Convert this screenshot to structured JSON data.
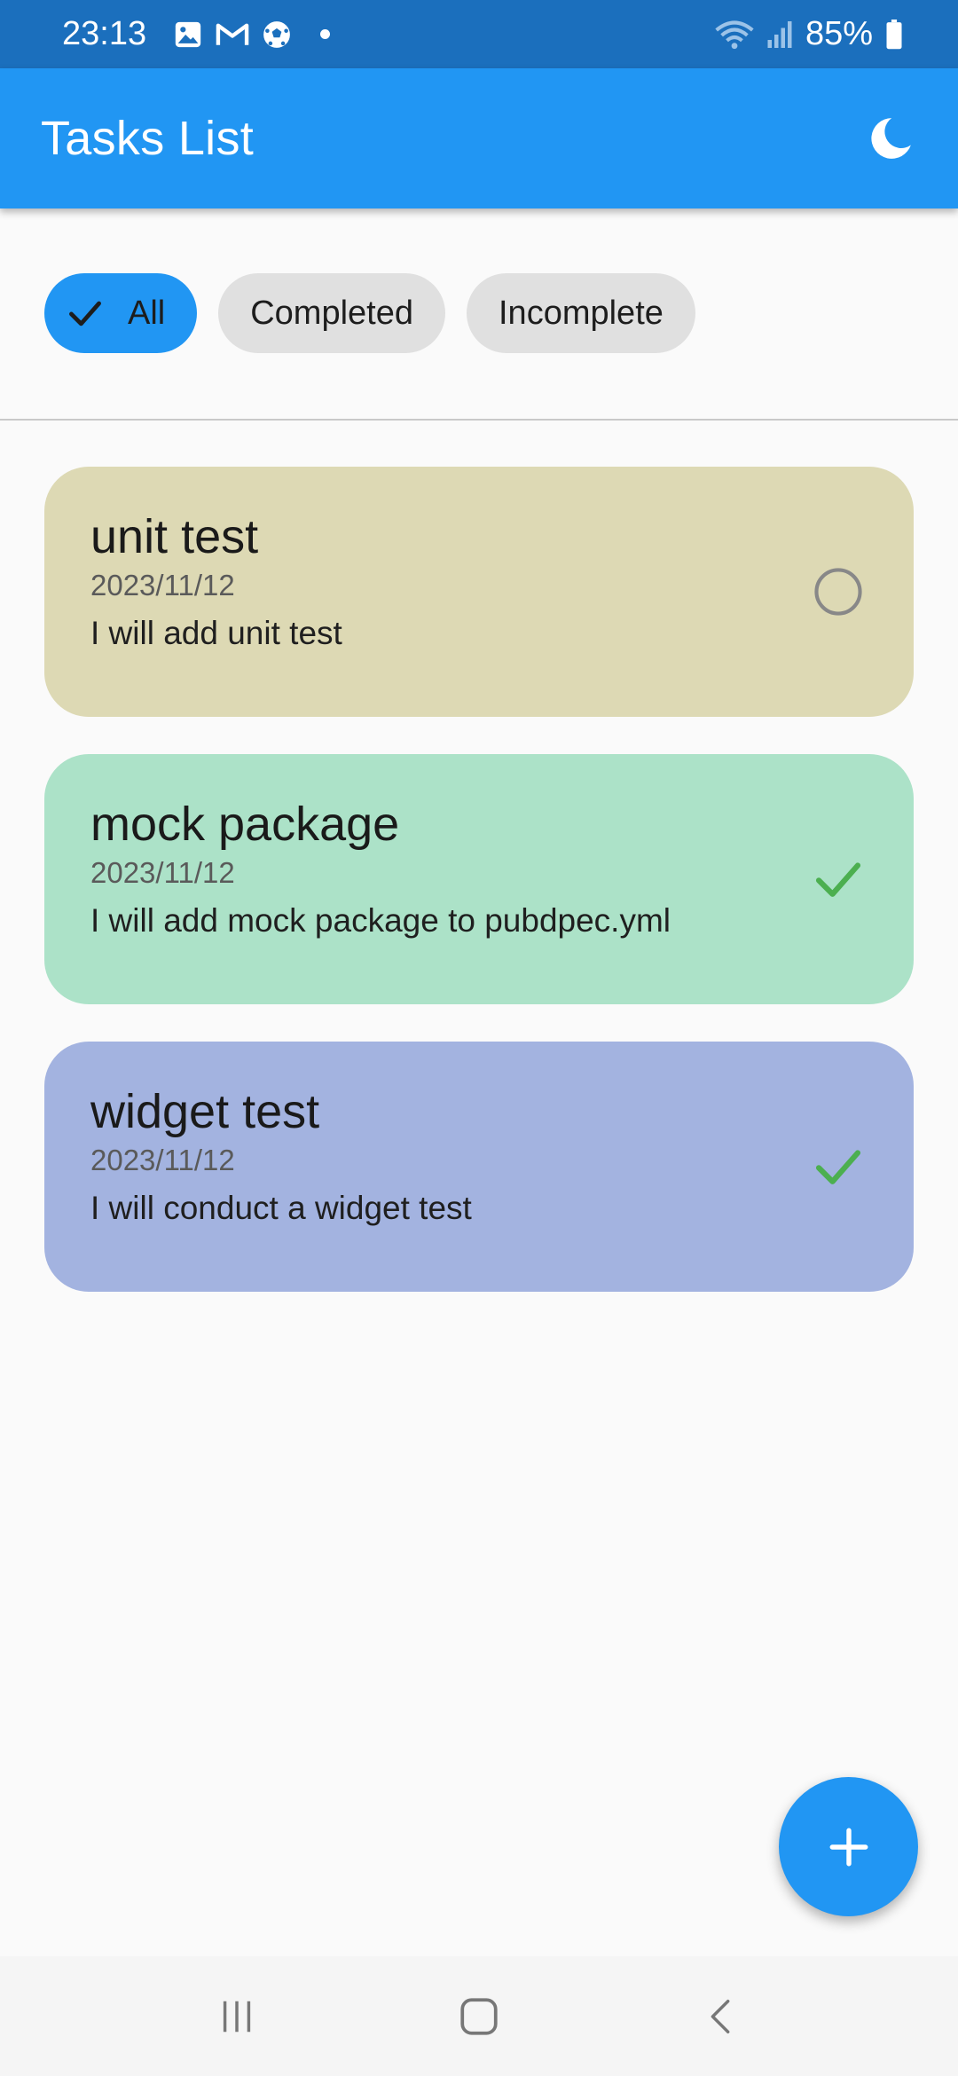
{
  "status_bar": {
    "time": "23:13",
    "battery": "85%",
    "left_icons": [
      "gallery-icon",
      "gmail-icon",
      "soccer-ball-icon"
    ],
    "right_icons": [
      "wifi-icon",
      "signal-icon",
      "battery-icon"
    ]
  },
  "app_bar": {
    "title": "Tasks List",
    "theme_icon": "moon-icon"
  },
  "filters": {
    "all": "All",
    "completed": "Completed",
    "incomplete": "Incomplete",
    "selected": "All"
  },
  "tasks": [
    {
      "title": "unit test",
      "date": "2023/11/12",
      "description": "I will add unit test",
      "completed": false,
      "color": "#ddd9b4"
    },
    {
      "title": "mock package",
      "date": "2023/11/12",
      "description": "I will add mock package to pubdpec.yml",
      "completed": true,
      "color": "#ace2c8"
    },
    {
      "title": "widget test",
      "date": "2023/11/12",
      "description": "I will conduct a widget test",
      "completed": true,
      "color": "#a3b3e0"
    }
  ],
  "fab": {
    "icon": "plus-icon"
  },
  "nav_bar": {
    "icons": [
      "recent-apps-icon",
      "home-icon",
      "back-icon"
    ]
  },
  "colors": {
    "status_bar": "#1b6fbd",
    "app_bar": "#2196f3",
    "chip_selected": "#2196f3",
    "chip_default": "#e0e0e0",
    "check_green": "#4caf50"
  }
}
